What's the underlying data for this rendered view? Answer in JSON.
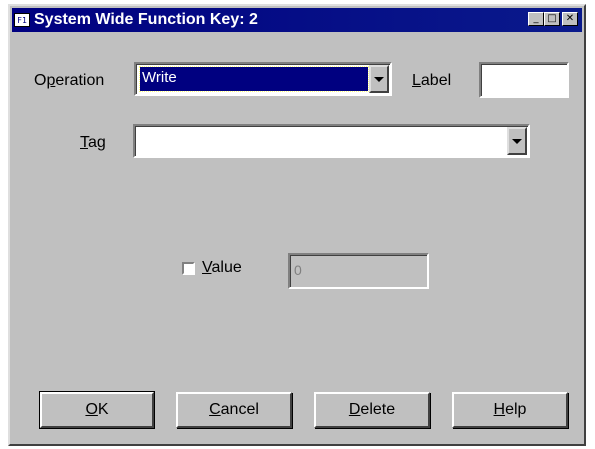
{
  "window": {
    "icon_text": "F1",
    "title": "System Wide Function Key: 2",
    "minimize_glyph": "_",
    "maximize_glyph": "□",
    "close_glyph": "✕"
  },
  "operation": {
    "label_first": "O",
    "label_rest": "peration",
    "label_pre": "",
    "value": "Write"
  },
  "label_field": {
    "label_first": "L",
    "label_rest": "abel",
    "value": ""
  },
  "tag": {
    "label_first": "T",
    "label_rest": "ag",
    "value": ""
  },
  "value_field": {
    "checked": false,
    "label_first": "V",
    "label_rest": "alue",
    "value": "0"
  },
  "buttons": {
    "ok": {
      "first": "O",
      "rest": "K"
    },
    "cancel": {
      "first": "C",
      "rest": "ancel"
    },
    "delete": {
      "first": "D",
      "rest": "elete"
    },
    "help": {
      "first": "H",
      "rest": "elp"
    }
  }
}
